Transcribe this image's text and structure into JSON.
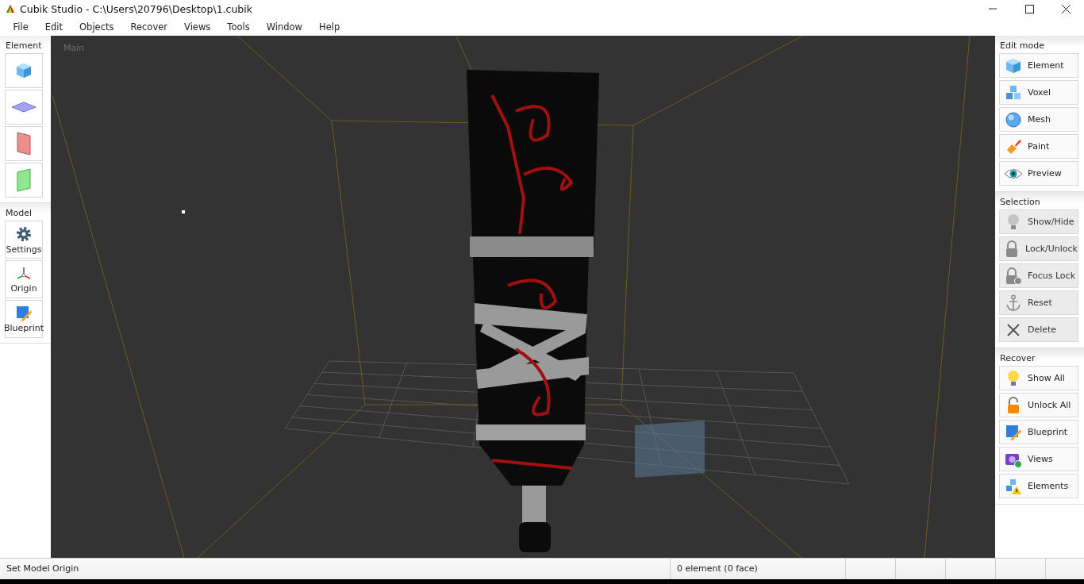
{
  "window": {
    "title": "Cubik Studio - C:\\Users\\20796\\Desktop\\1.cubik"
  },
  "menu": [
    "File",
    "Edit",
    "Objects",
    "Recover",
    "Views",
    "Tools",
    "Window",
    "Help"
  ],
  "left_panel": [
    {
      "title": "Element",
      "buttons": [
        {
          "kind": "cube"
        },
        {
          "kind": "plane-h"
        },
        {
          "kind": "plane-red"
        },
        {
          "kind": "plane-green"
        }
      ]
    },
    {
      "title": "Model",
      "buttons": [
        {
          "kind": "gear",
          "label": "Settings"
        },
        {
          "kind": "axes",
          "label": "Origin"
        },
        {
          "kind": "blueprint",
          "label": "Blueprint"
        }
      ]
    }
  ],
  "viewport": {
    "label": "Main"
  },
  "right_panel": [
    {
      "title": "Edit mode",
      "buttons": [
        {
          "kind": "cube",
          "label": "Element",
          "disabled": false
        },
        {
          "kind": "voxel",
          "label": "Voxel",
          "disabled": false
        },
        {
          "kind": "sphere",
          "label": "Mesh",
          "disabled": false
        },
        {
          "kind": "brush",
          "label": "Paint",
          "disabled": false
        },
        {
          "kind": "eye",
          "label": "Preview",
          "disabled": false
        }
      ]
    },
    {
      "title": "Selection",
      "buttons": [
        {
          "kind": "bulb",
          "label": "Show/Hide",
          "disabled": true
        },
        {
          "kind": "lock",
          "label": "Lock/Unlock",
          "disabled": true
        },
        {
          "kind": "lock-check",
          "label": "Focus Lock",
          "disabled": true
        },
        {
          "kind": "anchor",
          "label": "Reset",
          "disabled": true
        },
        {
          "kind": "cross",
          "label": "Delete",
          "disabled": true
        }
      ]
    },
    {
      "title": "Recover",
      "buttons": [
        {
          "kind": "bulb",
          "label": "Show All",
          "disabled": false
        },
        {
          "kind": "lock-open",
          "label": "Unlock All",
          "disabled": false
        },
        {
          "kind": "blueprint",
          "label": "Blueprint",
          "disabled": false
        },
        {
          "kind": "camera",
          "label": "Views",
          "disabled": false
        },
        {
          "kind": "voxel-warn",
          "label": "Elements",
          "disabled": false
        }
      ]
    }
  ],
  "status_bar": {
    "message": "Set Model Origin",
    "count": "0 element (0 face)"
  }
}
